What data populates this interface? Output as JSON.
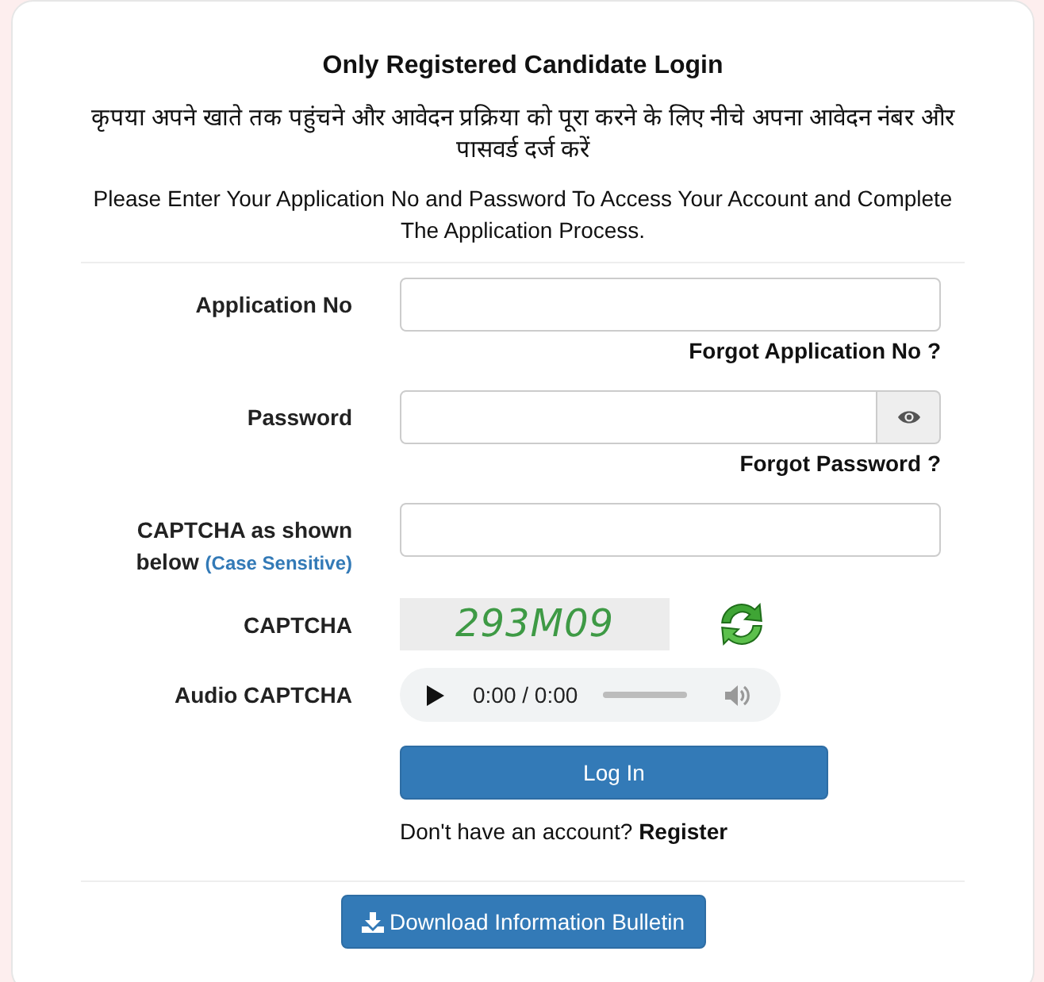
{
  "title": "Only Registered Candidate Login",
  "intro_hindi": "कृपया अपने खाते तक पहुंचने और आवेदन प्रक्रिया को पूरा करने के लिए नीचे अपना आवेदन नंबर और पासवर्ड दर्ज करें",
  "intro_english": "Please Enter Your Application No and Password To Access Your Account and Complete The Application Process.",
  "fields": [
    {
      "kind": "input",
      "label": "Application No",
      "help_link": "Forgot Application No ?"
    },
    {
      "kind": "password",
      "label": "Password",
      "help_link": "Forgot Password ?"
    },
    {
      "kind": "input",
      "label": "CAPTCHA as shown below",
      "note": "(Case Sensitive)"
    },
    {
      "kind": "captcha",
      "label": "CAPTCHA",
      "code": "293M09"
    },
    {
      "kind": "audio",
      "label": "Audio CAPTCHA",
      "time": "0:00 / 0:00"
    }
  ],
  "login_button": "Log In",
  "register": {
    "prompt": "Don't have an account?",
    "link": "Register"
  },
  "download_button": "Download Information Bulletin"
}
